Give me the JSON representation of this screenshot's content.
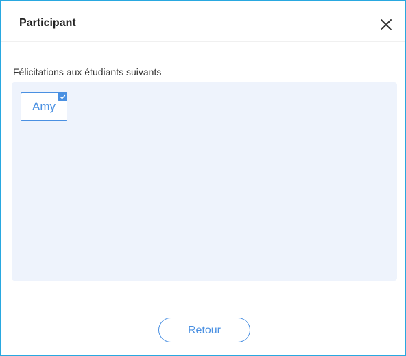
{
  "dialog": {
    "title": "Participant",
    "close_icon": "close-icon"
  },
  "section": {
    "label": "Félicitations aux étudiants suivants"
  },
  "students": [
    {
      "name": "Amy",
      "selected": true
    }
  ],
  "footer": {
    "back_label": "Retour"
  },
  "colors": {
    "accent": "#4a90e2",
    "frame": "#29a8e0",
    "panel_bg": "#eef3fc"
  }
}
